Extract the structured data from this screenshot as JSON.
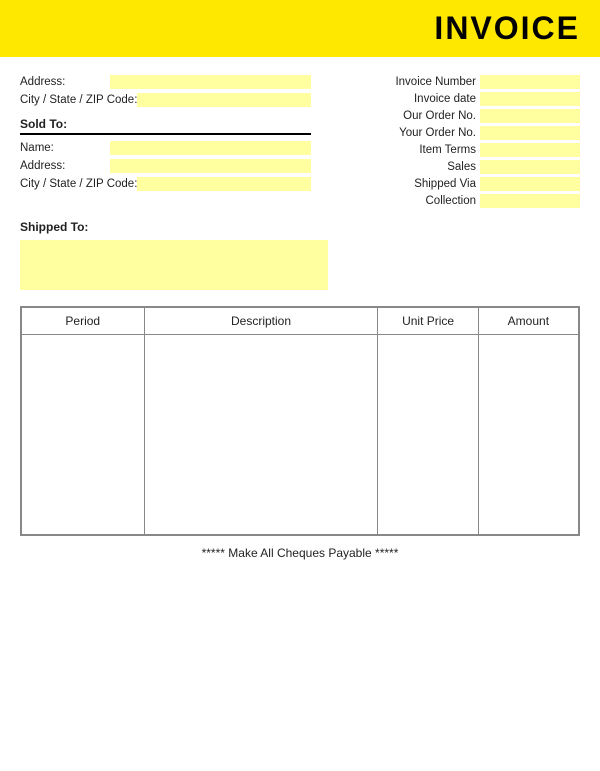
{
  "header": {
    "title": "INVOICE"
  },
  "left": {
    "address_label": "Address:",
    "city_label": "City / State / ZIP Code:",
    "sold_to_label": "Sold To:",
    "name_label": "Name:",
    "address2_label": "Address:",
    "city2_label": "City / State / ZIP Code:",
    "shipped_to_label": "Shipped To:"
  },
  "right": {
    "invoice_number_label": "Invoice Number",
    "invoice_date_label": "Invoice date",
    "our_order_label": "Our Order No.",
    "your_order_label": "Your Order No.",
    "item_terms_label": "Item Terms",
    "sales_label": "Sales",
    "shipped_via_label": "Shipped Via",
    "collection_label": "Collection"
  },
  "table": {
    "col_period": "Period",
    "col_description": "Description",
    "col_unit_price": "Unit Price",
    "col_amount": "Amount"
  },
  "footer": {
    "text": "***** Make All Cheques Payable *****"
  }
}
